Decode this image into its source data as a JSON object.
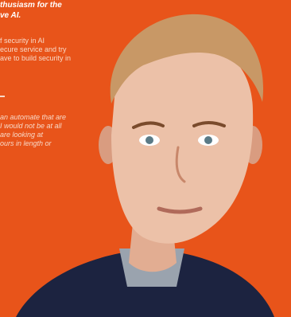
{
  "article": {
    "headline": "thusiasm for the\nve AI.",
    "para1": "f security in AI\necure service and try\nave to build security in",
    "para2": "an automate that are\nI would not be at all\nare looking at\nours in length or"
  }
}
